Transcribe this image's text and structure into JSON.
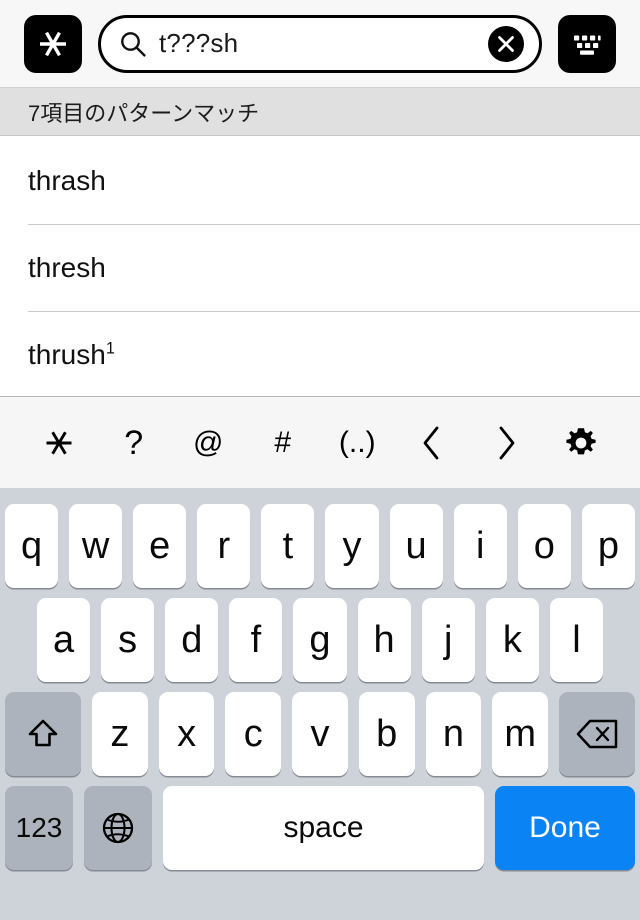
{
  "searchbar": {
    "wildcard_button_icon": "asterisk-icon",
    "search_value": "t???sh",
    "search_placeholder": "",
    "search_icon": "magnifier-icon",
    "clear_icon": "clear-circle-icon",
    "keyboard_button_icon": "keyboard-icon"
  },
  "results": {
    "header": "7項目のパターンマッチ",
    "items": [
      {
        "word": "thrash",
        "sup": ""
      },
      {
        "word": "thresh",
        "sup": ""
      },
      {
        "word": "thrush",
        "sup": "1"
      }
    ]
  },
  "accessory_bar": {
    "buttons": [
      {
        "label": "✳",
        "name": "asterisk-wildcard-button"
      },
      {
        "label": "?",
        "name": "question-wildcard-button"
      },
      {
        "label": "@",
        "name": "at-wildcard-button"
      },
      {
        "label": "#",
        "name": "hash-wildcard-button"
      },
      {
        "label": "(..)",
        "name": "group-wildcard-button"
      },
      {
        "label": "‹",
        "name": "previous-button"
      },
      {
        "label": "›",
        "name": "next-button"
      },
      {
        "label": "⚙",
        "name": "settings-gear-button"
      }
    ]
  },
  "keyboard": {
    "row1": [
      "q",
      "w",
      "e",
      "r",
      "t",
      "y",
      "u",
      "i",
      "o",
      "p"
    ],
    "row2": [
      "a",
      "s",
      "d",
      "f",
      "g",
      "h",
      "j",
      "k",
      "l"
    ],
    "row3": [
      "z",
      "x",
      "c",
      "v",
      "b",
      "n",
      "m"
    ],
    "shift_label": "shift-icon",
    "backspace_label": "backspace-icon",
    "numbers_label": "123",
    "globe_label": "globe-icon",
    "space_label": "space",
    "done_label": "Done"
  },
  "colors": {
    "done_blue": "#0a84f5",
    "keyboard_bg": "#ced2d9",
    "key_white": "#ffffff",
    "key_gray": "#adb3bd",
    "header_gray": "#e0e0e0",
    "accessory_bg": "#f6f6f6"
  }
}
